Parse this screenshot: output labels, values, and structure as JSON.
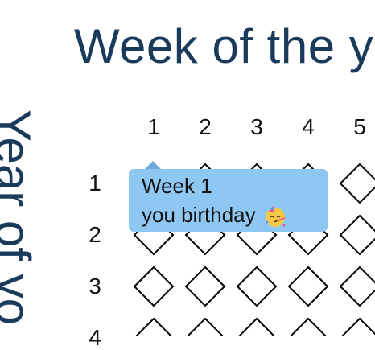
{
  "title": "Week of the y",
  "y_axis_label": "Year of yo",
  "columns": [
    "1",
    "2",
    "3",
    "4",
    "5"
  ],
  "rows": [
    "1",
    "2",
    "3",
    "4"
  ],
  "tooltip": {
    "line1": "Week 1",
    "line2": "you birthday",
    "emoji": "party-face-icon"
  },
  "colors": {
    "title": "#1a3a5c",
    "tooltip_bg": "#8ec7f2",
    "highlight_week": "#5b9be0",
    "diamond_stroke": "#000000"
  }
}
